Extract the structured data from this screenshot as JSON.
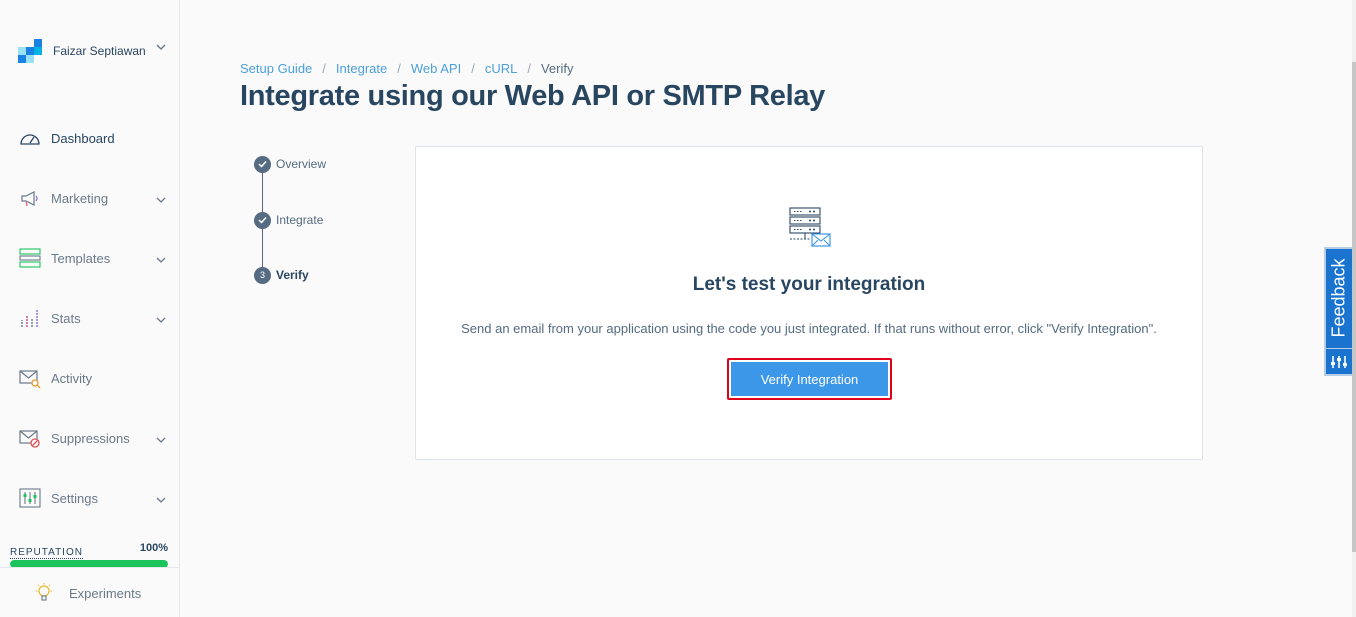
{
  "sidebar": {
    "account_name": "Faizar Septiawan",
    "items": [
      {
        "label": "Dashboard",
        "icon": "dashboard-gauge-icon",
        "has_chevron": false
      },
      {
        "label": "Marketing",
        "icon": "megaphone-icon",
        "has_chevron": true
      },
      {
        "label": "Templates",
        "icon": "templates-icon",
        "has_chevron": true
      },
      {
        "label": "Stats",
        "icon": "stats-bar-chart-icon",
        "has_chevron": true
      },
      {
        "label": "Activity",
        "icon": "activity-mail-search-icon",
        "has_chevron": false
      },
      {
        "label": "Suppressions",
        "icon": "suppressions-mail-block-icon",
        "has_chevron": true
      },
      {
        "label": "Settings",
        "icon": "settings-sliders-icon",
        "has_chevron": true
      }
    ],
    "reputation_label": "REPUTATION",
    "reputation_value": "100%",
    "reputation_fraction": 1.0,
    "experiments_label": "Experiments"
  },
  "breadcrumb": {
    "items": [
      "Setup Guide",
      "Integrate",
      "Web API",
      "cURL"
    ],
    "current": "Verify",
    "separator": "/"
  },
  "page_title": "Integrate using our Web API or SMTP Relay",
  "steps": [
    {
      "label": "Overview",
      "marker": "✓"
    },
    {
      "label": "Integrate",
      "marker": "✓"
    },
    {
      "label": "Verify",
      "marker": "3"
    }
  ],
  "card": {
    "title": "Let's test your integration",
    "description": "Send an email from your application using the code you just integrated. If that runs without error, click \"Verify Integration\".",
    "button_label": "Verify Integration"
  },
  "feedback_label": "Feedback",
  "colors": {
    "brand_dark": "#294661",
    "link": "#4b9fdb",
    "primary_button": "#3d97e8",
    "reputation_green": "#1bc45a",
    "feedback_blue": "#1a74cf",
    "highlight_red": "#e0001b"
  }
}
